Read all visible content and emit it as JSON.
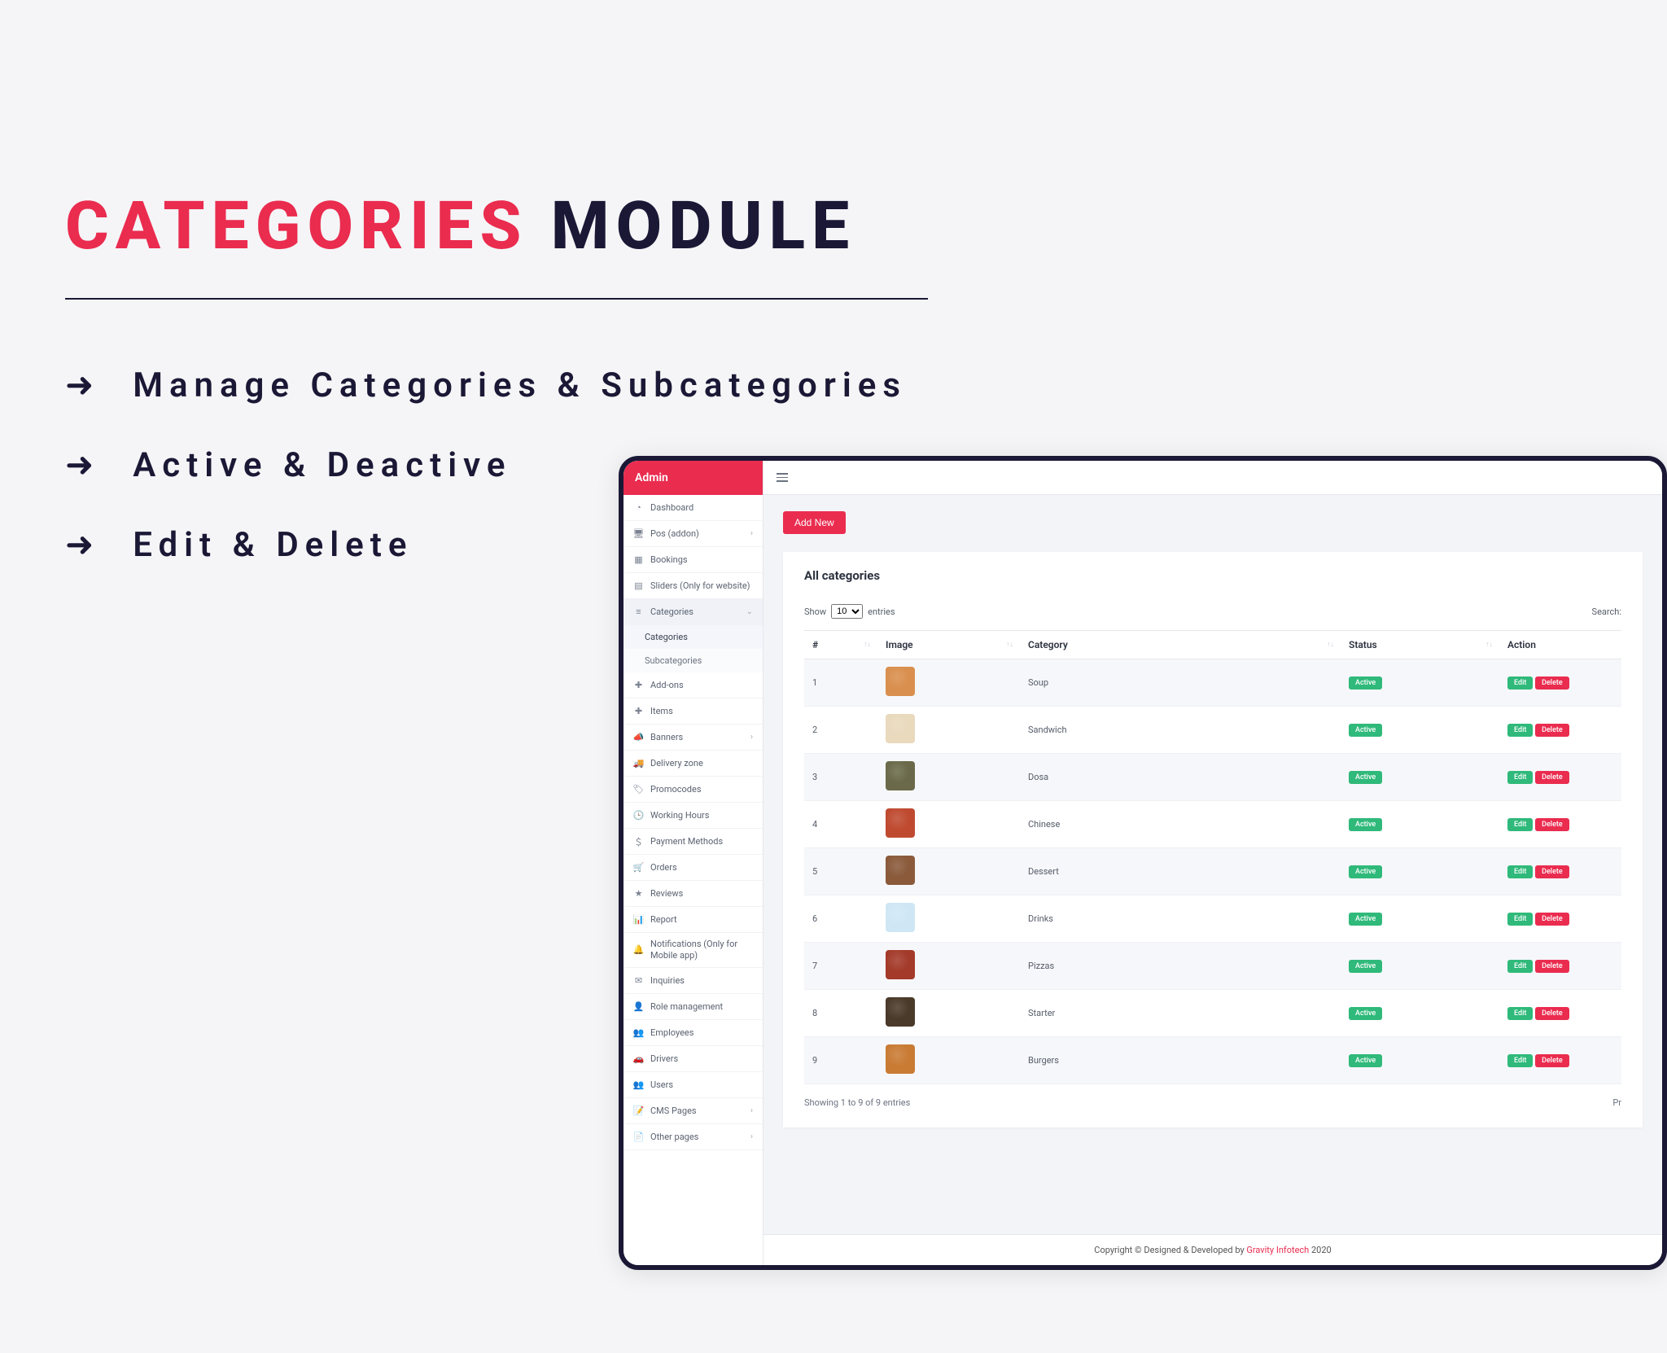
{
  "hero": {
    "title_accent": "CATEGORIES",
    "title_rest": " MODULE",
    "bullets": [
      "Manage Categories & Subcategories",
      "Active & Deactive",
      "Edit & Delete"
    ]
  },
  "sidebar": {
    "brand": "Admin",
    "items": [
      {
        "icon": "gauge",
        "label": "Dashboard"
      },
      {
        "icon": "register",
        "label": "Pos (addon)",
        "expandable": true
      },
      {
        "icon": "calendar",
        "label": "Bookings"
      },
      {
        "icon": "sliders",
        "label": "Sliders (Only for website)"
      },
      {
        "icon": "list",
        "label": "Categories",
        "expandable": true,
        "active": true,
        "children": [
          {
            "label": "Categories",
            "selected": true
          },
          {
            "label": "Subcategories"
          }
        ]
      },
      {
        "icon": "plus",
        "label": "Add-ons"
      },
      {
        "icon": "plus",
        "label": "Items"
      },
      {
        "icon": "megaphone",
        "label": "Banners",
        "expandable": true
      },
      {
        "icon": "truck",
        "label": "Delivery zone"
      },
      {
        "icon": "tag",
        "label": "Promocodes"
      },
      {
        "icon": "clock",
        "label": "Working Hours"
      },
      {
        "icon": "dollar",
        "label": "Payment Methods"
      },
      {
        "icon": "cart",
        "label": "Orders"
      },
      {
        "icon": "star",
        "label": "Reviews"
      },
      {
        "icon": "chart",
        "label": "Report"
      },
      {
        "icon": "bell",
        "label": "Notifications (Only for Mobile app)",
        "two_line": true
      },
      {
        "icon": "mail",
        "label": "Inquiries"
      },
      {
        "icon": "user",
        "label": "Role management"
      },
      {
        "icon": "users",
        "label": "Employees"
      },
      {
        "icon": "car",
        "label": "Drivers"
      },
      {
        "icon": "users2",
        "label": "Users"
      },
      {
        "icon": "page",
        "label": "CMS Pages",
        "expandable": true
      },
      {
        "icon": "page2",
        "label": "Other pages",
        "expandable": true
      }
    ]
  },
  "content": {
    "add_button": "Add New",
    "card_title": "All categories",
    "show_label": "Show",
    "entries_label": "entries",
    "entries_value": "10",
    "search_label": "Search:",
    "columns": {
      "num": "#",
      "image": "Image",
      "category": "Category",
      "status": "Status",
      "action": "Action"
    },
    "status_active": "Active",
    "edit_label": "Edit",
    "delete_label": "Delete",
    "rows": [
      {
        "n": "1",
        "name": "Soup",
        "color": "#d98f4e"
      },
      {
        "n": "2",
        "name": "Sandwich",
        "color": "#e9d9bd"
      },
      {
        "n": "3",
        "name": "Dosa",
        "color": "#6a6a4a"
      },
      {
        "n": "4",
        "name": "Chinese",
        "color": "#bf4a30"
      },
      {
        "n": "5",
        "name": "Dessert",
        "color": "#8a5a3b"
      },
      {
        "n": "6",
        "name": "Drinks",
        "color": "#cfe7f5"
      },
      {
        "n": "7",
        "name": "Pizzas",
        "color": "#a33a2a"
      },
      {
        "n": "8",
        "name": "Starter",
        "color": "#4a3a2a"
      },
      {
        "n": "9",
        "name": "Burgers",
        "color": "#c97b34"
      }
    ],
    "info": "Showing 1 to 9 of 9 entries",
    "prev": "Pr"
  },
  "footer": {
    "pre": "Copyright © Designed & Developed by ",
    "brand": "Gravity Infotech",
    "year": " 2020"
  }
}
